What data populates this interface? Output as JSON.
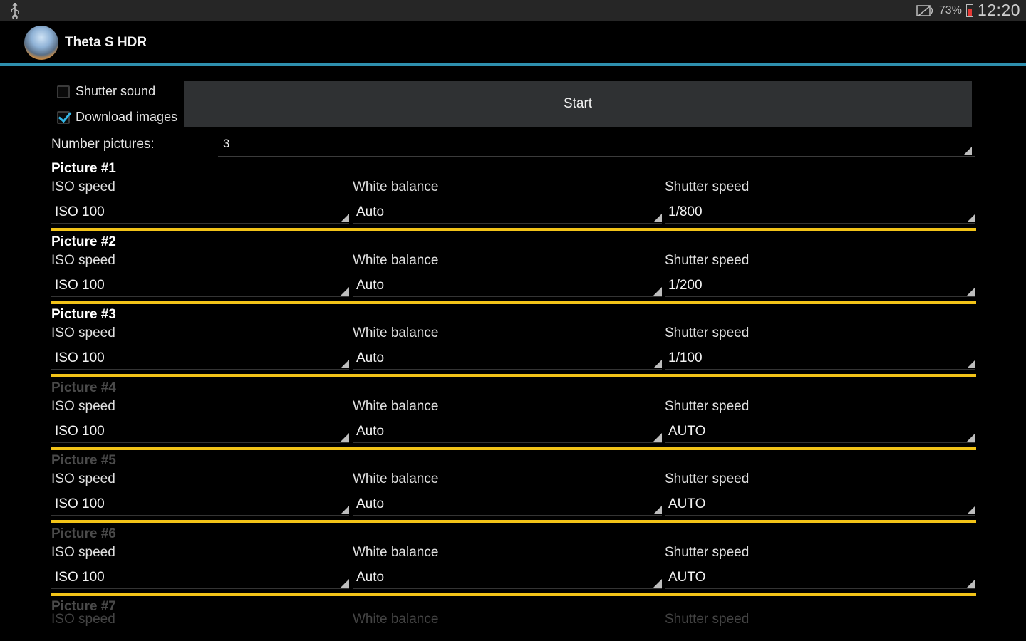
{
  "status_bar": {
    "battery_pct": "73%",
    "clock": "12:20",
    "icons": [
      "usb-icon",
      "mute-icon",
      "battery-icon"
    ]
  },
  "action_bar": {
    "title": "Theta S HDR",
    "icon": "app-icon"
  },
  "controls": {
    "shutter_sound_label": "Shutter sound",
    "shutter_sound_checked": false,
    "download_images_label": "Download images",
    "download_images_checked": true,
    "start_label": "Start",
    "number_pictures_label": "Number pictures:",
    "number_pictures_value": "3"
  },
  "field_labels": {
    "iso": "ISO speed",
    "wb": "White balance",
    "shutter": "Shutter speed"
  },
  "pictures": [
    {
      "title": "Picture #1",
      "enabled": true,
      "iso": "ISO 100",
      "wb": "Auto",
      "shutter": "1/800"
    },
    {
      "title": "Picture #2",
      "enabled": true,
      "iso": "ISO 100",
      "wb": "Auto",
      "shutter": "1/200"
    },
    {
      "title": "Picture #3",
      "enabled": true,
      "iso": "ISO 100",
      "wb": "Auto",
      "shutter": "1/100"
    },
    {
      "title": "Picture #4",
      "enabled": false,
      "iso": "ISO 100",
      "wb": "Auto",
      "shutter": "AUTO"
    },
    {
      "title": "Picture #5",
      "enabled": false,
      "iso": "ISO 100",
      "wb": "Auto",
      "shutter": "AUTO"
    },
    {
      "title": "Picture #6",
      "enabled": false,
      "iso": "ISO 100",
      "wb": "Auto",
      "shutter": "AUTO"
    },
    {
      "title": "Picture #7",
      "enabled": false,
      "iso": "",
      "wb": "",
      "shutter": ""
    }
  ],
  "colors": {
    "accent": "#33b5e5",
    "divider": "#2e8fae",
    "separator": "#f2c318",
    "button_bg": "#2f3133"
  }
}
